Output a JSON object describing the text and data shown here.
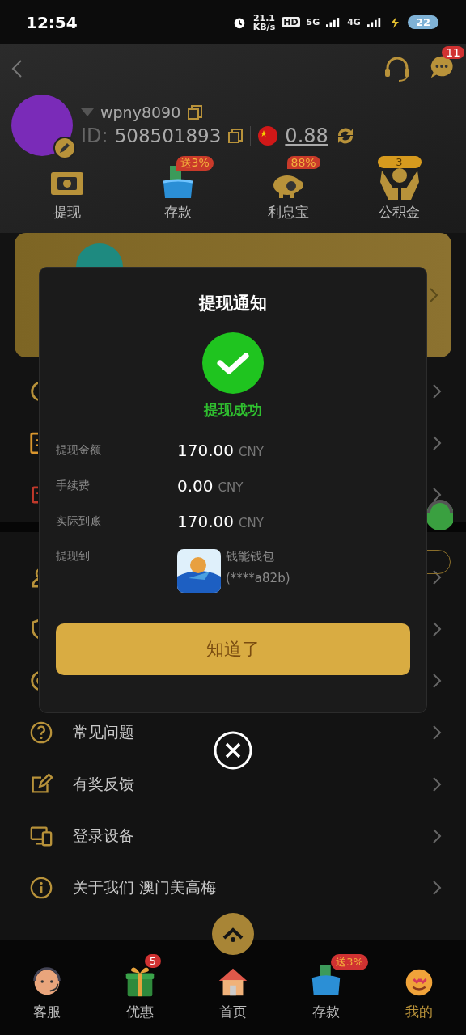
{
  "status_bar": {
    "time": "12:54",
    "speed": "21.1",
    "speed_unit": "KB/s",
    "hd": "HD",
    "net_1": "5G",
    "net_2": "4G",
    "battery": "22"
  },
  "header": {
    "messages_badge": "11",
    "username": "wpny8090",
    "id_label": "ID:",
    "id": "508501893",
    "balance": "0.88"
  },
  "shortcuts": [
    {
      "label": "提现"
    },
    {
      "label": "存款",
      "badge": "送3%"
    },
    {
      "label": "利息宝",
      "badge": "88%"
    },
    {
      "label": "公积金",
      "badge": "3"
    }
  ],
  "menu": [
    {
      "label": "常见问题"
    },
    {
      "label": "有奖反馈"
    },
    {
      "label": "登录设备"
    },
    {
      "label": "关于我们 澳门美高梅"
    }
  ],
  "dialog": {
    "title": "提现通知",
    "status": "提现成功",
    "rows": [
      {
        "label": "提现金额",
        "amount": "170.00",
        "currency": "CNY"
      },
      {
        "label": "手续费",
        "amount": "0.00",
        "currency": "CNY"
      },
      {
        "label": "实际到账",
        "amount": "170.00",
        "currency": "CNY"
      }
    ],
    "destination": {
      "label": "提现到",
      "wallet": "钱能钱包",
      "account": "(****a82b)"
    },
    "button": "知道了"
  },
  "tabs": [
    {
      "label": "客服",
      "selected": false
    },
    {
      "label": "优惠",
      "badge": "5",
      "selected": false
    },
    {
      "label": "首页",
      "selected": false
    },
    {
      "label": "存款",
      "badge": "送3%",
      "selected": false
    },
    {
      "label": "我的",
      "selected": true
    }
  ]
}
